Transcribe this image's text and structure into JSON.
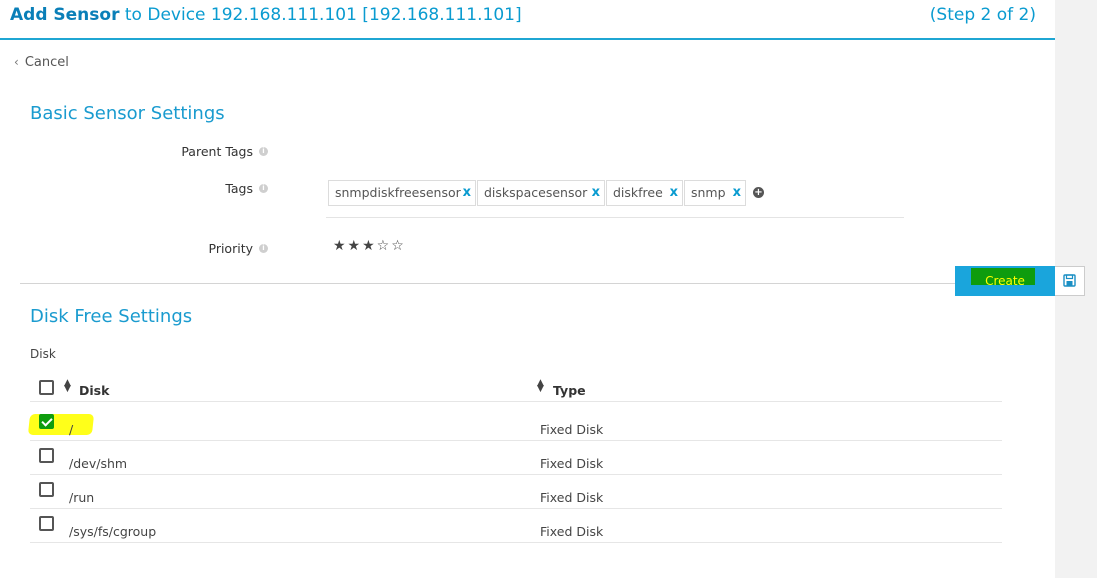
{
  "header": {
    "title_bold": "Add Sensor",
    "title_rest": "to Device 192.168.111.101 [192.168.111.101]",
    "step": "(Step 2 of 2)"
  },
  "nav": {
    "cancel_label": "Cancel"
  },
  "basic": {
    "section_title": "Basic Sensor Settings",
    "parent_tags_label": "Parent Tags",
    "tags_label": "Tags",
    "priority_label": "Priority",
    "tags": [
      "snmpdiskfreesensor",
      "diskspacesensor",
      "diskfree",
      "snmp"
    ],
    "tag_remove_glyph": "x",
    "info_glyph": "i",
    "priority_stars": "★★★☆☆",
    "priority_value": 3,
    "priority_max": 5
  },
  "actions": {
    "create_label": "Create"
  },
  "disk": {
    "section_title": "Disk Free Settings",
    "field_label": "Disk",
    "columns": [
      "Disk",
      "Type"
    ],
    "rows": [
      {
        "disk": "/",
        "type": "Fixed Disk",
        "checked": true
      },
      {
        "disk": "/dev/shm",
        "type": "Fixed Disk",
        "checked": false
      },
      {
        "disk": "/run",
        "type": "Fixed Disk",
        "checked": false
      },
      {
        "disk": "/sys/fs/cgroup",
        "type": "Fixed Disk",
        "checked": false
      }
    ]
  },
  "colors": {
    "accent": "#1aa5dc",
    "title_blue": "#0a9bd0",
    "check_green": "#0e9c0e",
    "highlight_yellow": "#ffff1a"
  },
  "icons": {
    "cancel": "chevron-left-icon",
    "info": "info-icon",
    "tag_remove": "close-icon",
    "add_tag": "plus-circle-icon",
    "save": "floppy-disk-icon",
    "sort": "sort-icon"
  }
}
